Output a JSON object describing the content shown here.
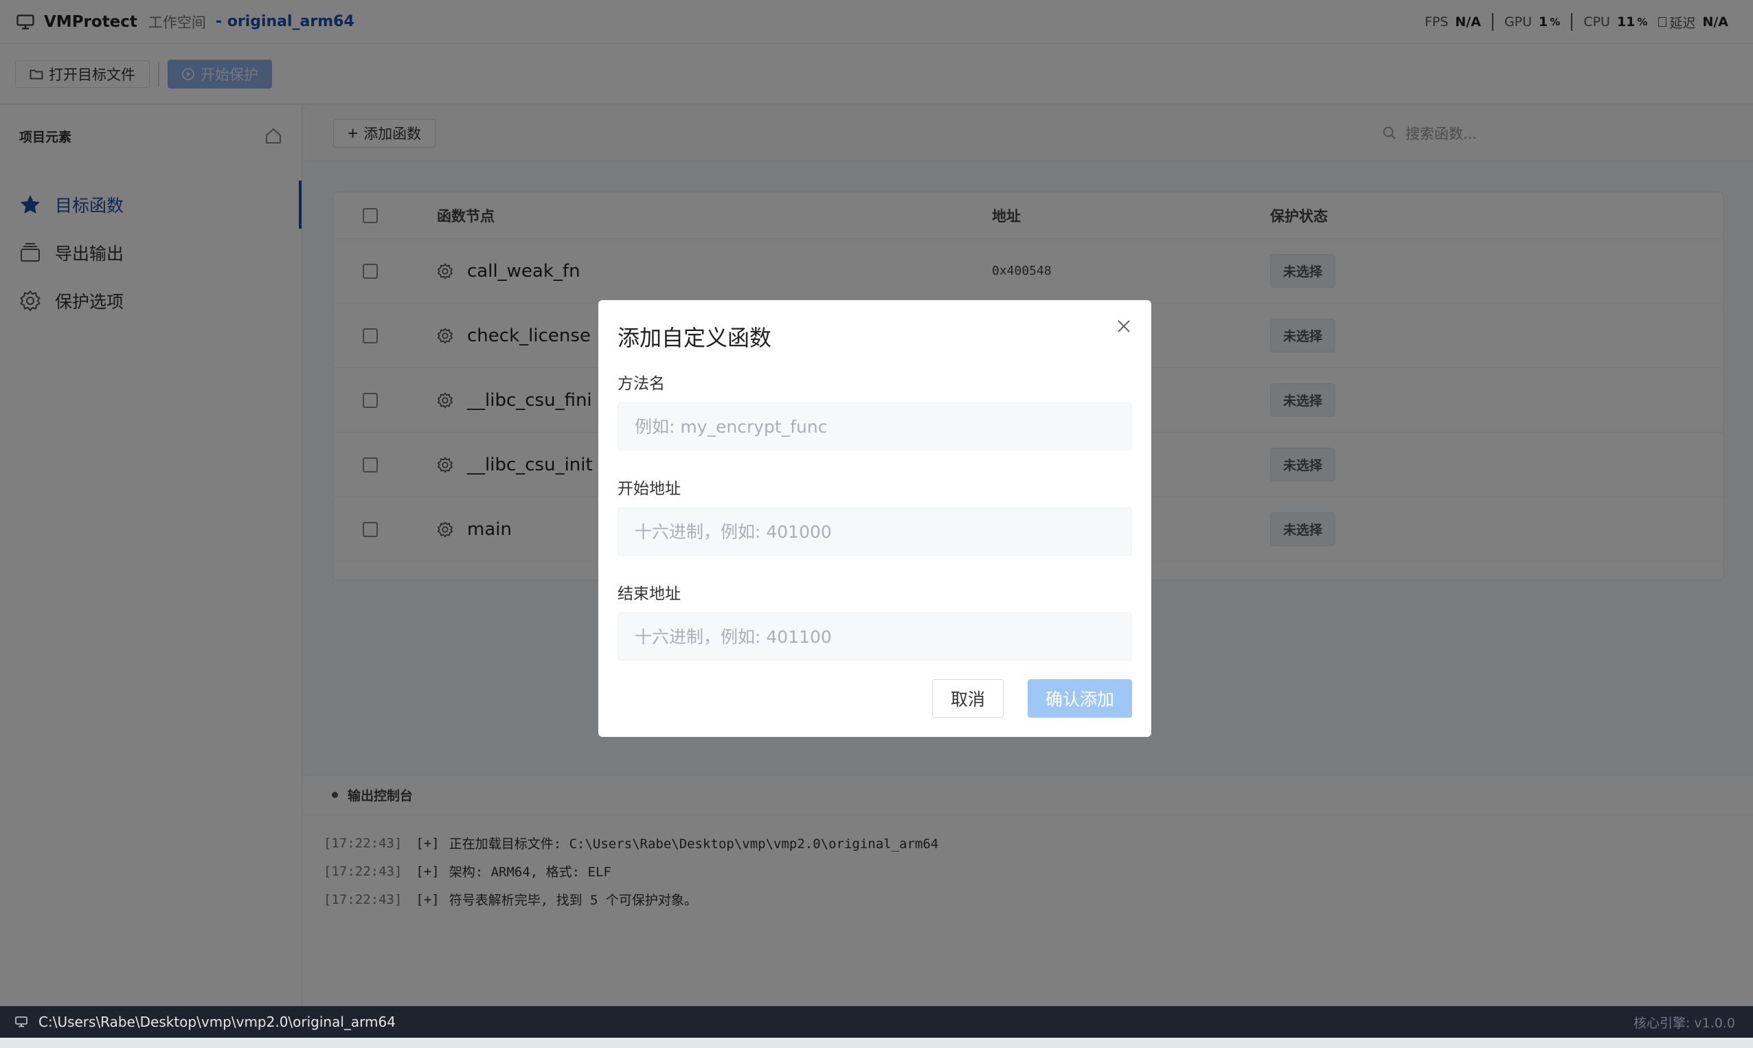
{
  "titlebar": {
    "app_name": "VMProtect",
    "workspace": "工作空间",
    "project": "- original_arm64",
    "metrics": [
      {
        "label": "FPS",
        "value": "N/A",
        "unit": ""
      },
      {
        "label": "GPU",
        "value": "1",
        "unit": "%"
      },
      {
        "label": "CPU",
        "value": "11",
        "unit": "%"
      },
      {
        "label": "延迟",
        "value": "N/A",
        "unit": ""
      }
    ]
  },
  "toolbar": {
    "open_label": "打开目标文件",
    "start_label": "开始保护"
  },
  "sidebar": {
    "title": "项目元素",
    "items": [
      {
        "label": "目标函数",
        "icon": "star-icon",
        "active": true
      },
      {
        "label": "导出输出",
        "icon": "layers-icon",
        "active": false
      },
      {
        "label": "保护选项",
        "icon": "gear-icon",
        "active": false
      }
    ]
  },
  "main": {
    "add_label": "添加函数",
    "search_placeholder": "搜索函数...",
    "table": {
      "headers": {
        "name": "函数节点",
        "address": "地址",
        "status": "保护状态"
      },
      "rows": [
        {
          "name": "call_weak_fn",
          "address": "0x400548",
          "status": "未选择"
        },
        {
          "name": "check_license",
          "address": "",
          "status": "未选择"
        },
        {
          "name": "__libc_csu_fini",
          "address": "",
          "status": "未选择"
        },
        {
          "name": "__libc_csu_init",
          "address": "",
          "status": "未选择"
        },
        {
          "name": "main",
          "address": "",
          "status": "未选择"
        }
      ]
    }
  },
  "console": {
    "title": "输出控制台",
    "lines": [
      {
        "time": "[17:22:43]",
        "tag": "[+]",
        "text": "正在加载目标文件: C:\\Users\\Rabe\\Desktop\\vmp\\vmp2.0\\original_arm64"
      },
      {
        "time": "[17:22:43]",
        "tag": "[+]",
        "text": "架构: ARM64, 格式: ELF"
      },
      {
        "time": "[17:22:43]",
        "tag": "[+]",
        "text": "符号表解析完毕, 找到 5 个可保护对象。"
      }
    ]
  },
  "statusbar": {
    "path": "C:\\Users\\Rabe\\Desktop\\vmp\\vmp2.0\\original_arm64",
    "engine": "核心引擎: v1.0.0"
  },
  "modal": {
    "title": "添加自定义函数",
    "fields": [
      {
        "label": "方法名",
        "placeholder": "例如: my_encrypt_func",
        "value": ""
      },
      {
        "label": "开始地址",
        "placeholder": "十六进制，例如: 401000",
        "value": ""
      },
      {
        "label": "结束地址",
        "placeholder": "十六进制，例如: 401100",
        "value": ""
      }
    ],
    "cancel_label": "取消",
    "confirm_label": "确认添加"
  },
  "colors": {
    "accent": "#1f4fa8",
    "confirm_button": "#9ec7f6",
    "statusbar_bg": "#1e2330"
  }
}
